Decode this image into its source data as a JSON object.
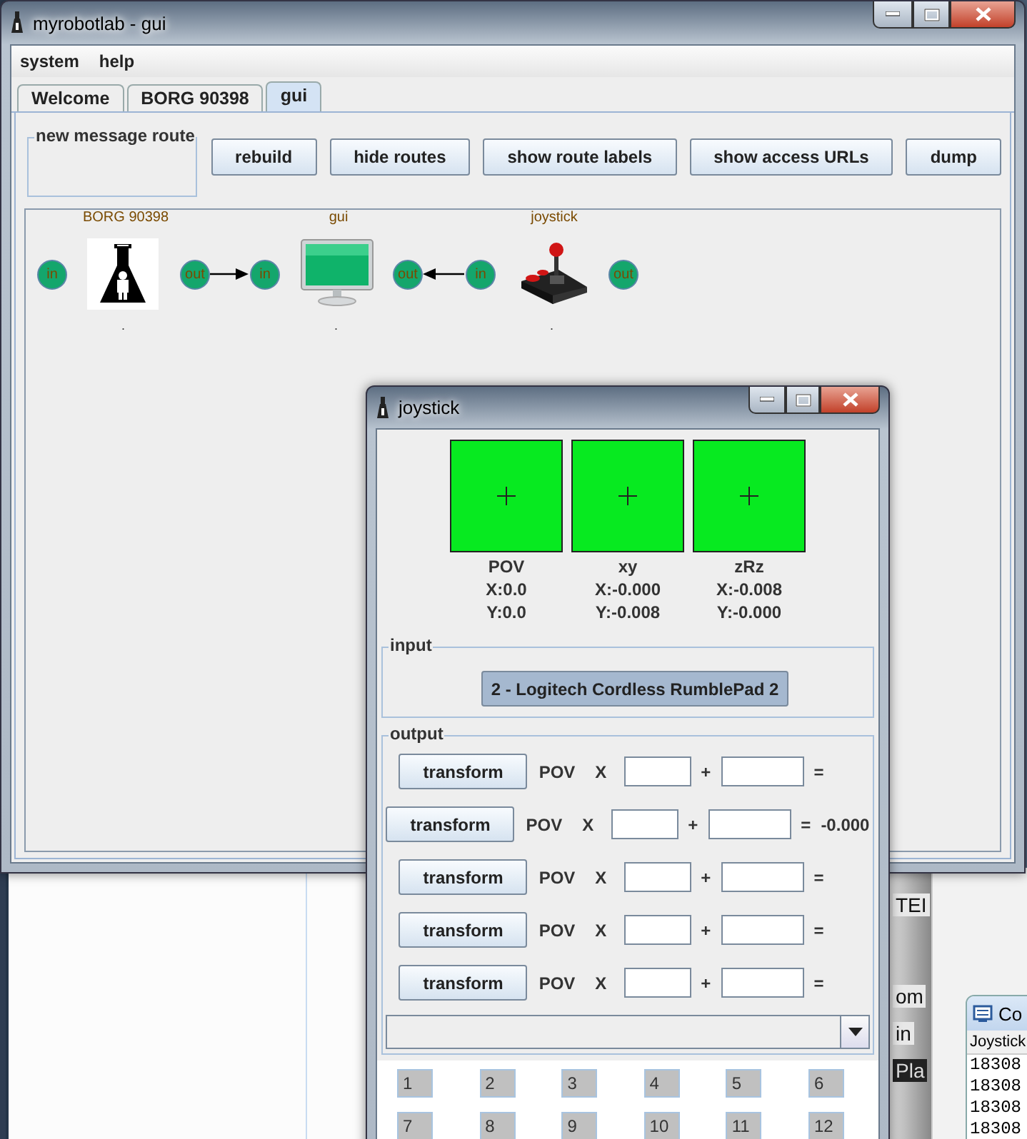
{
  "main_window": {
    "title": "myrobotlab - gui"
  },
  "menu": [
    "system",
    "help"
  ],
  "tabs": [
    {
      "label": "Welcome",
      "selected": false
    },
    {
      "label": "BORG 90398",
      "selected": false
    },
    {
      "label": "gui",
      "selected": true
    }
  ],
  "route_panel": {
    "legend": "new message route"
  },
  "toolbar": [
    "rebuild",
    "hide routes",
    "show route labels",
    "show access URLs",
    "dump"
  ],
  "services": [
    {
      "name": "BORG 90398",
      "kind": "flask",
      "in": "in",
      "out": "out",
      "caption": ".",
      "routes_to_next": true,
      "routes_to_previous": false
    },
    {
      "name": "gui",
      "kind": "monitor",
      "in": "in",
      "out": "out",
      "caption": ".",
      "routes_to_next": false,
      "routes_to_previous": false
    },
    {
      "name": "joystick",
      "kind": "joystick",
      "in": "in",
      "out": "out",
      "caption": ".",
      "routes_to_next": false,
      "routes_to_previous": true
    }
  ],
  "joystick_window": {
    "title": "joystick",
    "displays": [
      {
        "name": "POV",
        "x": "X:0.0",
        "y": "Y:0.0"
      },
      {
        "name": "xy",
        "x": "X:-0.000",
        "y": "Y:-0.008"
      },
      {
        "name": "zRz",
        "x": "X:-0.008",
        "y": "Y:-0.000"
      }
    ],
    "input": {
      "legend": "input",
      "device": "2 - Logitech Cordless RumblePad 2"
    },
    "output": {
      "legend": "output",
      "rows": [
        {
          "button": "transform",
          "axis": "POV",
          "x_label": "X",
          "plus": "+",
          "equals": "="
        },
        {
          "button": "transform",
          "axis": "POV",
          "x_label": "X",
          "plus": "+",
          "equals": "=",
          "result": "-0.000"
        },
        {
          "button": "transform",
          "axis": "POV",
          "x_label": "X",
          "plus": "+",
          "equals": "="
        },
        {
          "button": "transform",
          "axis": "POV",
          "x_label": "X",
          "plus": "+",
          "equals": "="
        },
        {
          "button": "transform",
          "axis": "POV",
          "x_label": "X",
          "plus": "+",
          "equals": "="
        }
      ]
    },
    "buttons": [
      "1",
      "2",
      "3",
      "4",
      "5",
      "6",
      "7",
      "8",
      "9",
      "10",
      "11",
      "12"
    ]
  },
  "background": {
    "fragments": [
      "TEI",
      "om",
      "in",
      "Pla"
    ],
    "console": {
      "title": "Co",
      "header": "Joystick",
      "lines": [
        "18308",
        "18308",
        "18308",
        "18308"
      ]
    }
  }
}
